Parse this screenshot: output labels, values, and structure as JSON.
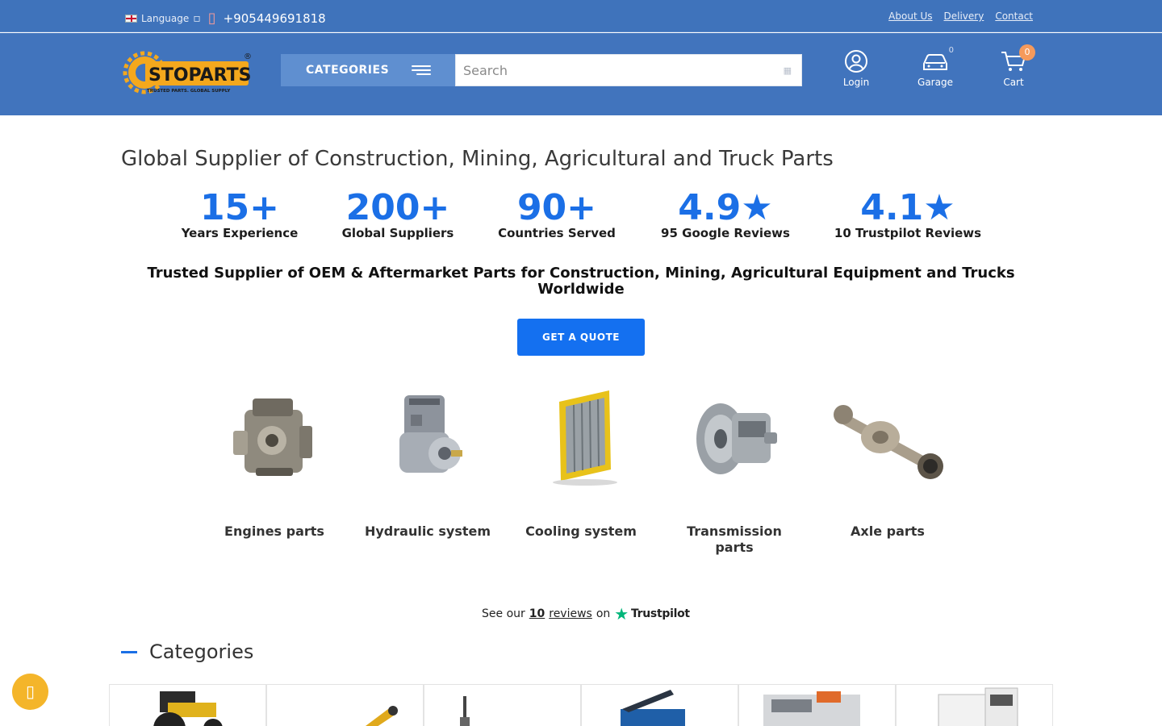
{
  "topbar": {
    "language_label": "Language",
    "phone": "+905449691818",
    "links": [
      "About Us",
      "Delivery",
      "Contact"
    ]
  },
  "header": {
    "logo_text": "STOPARTS",
    "logo_tagline": "TRUSTED PARTS. GLOBAL SUPPLY",
    "categories_label": "CATEGORIES",
    "search_placeholder": "Search",
    "login_label": "Login",
    "garage_label": "Garage",
    "garage_count": "0",
    "cart_label": "Cart",
    "cart_count": "0"
  },
  "main": {
    "headline": "Global Supplier of Construction, Mining, Agricultural and Truck Parts",
    "stats": [
      {
        "num": "15+",
        "label": "Years Experience"
      },
      {
        "num": "200+",
        "label": "Global Suppliers"
      },
      {
        "num": "90+",
        "label": "Countries Served"
      },
      {
        "num": "4.9★",
        "label": "95 Google Reviews"
      },
      {
        "num": "4.1★",
        "label": "10 Trustpilot Reviews"
      }
    ],
    "tagline": "Trusted Supplier of OEM & Aftermarket Parts for Construction, Mining, Agricultural Equipment and Trucks Worldwide",
    "quote_button": "GET A QUOTE",
    "parts": [
      {
        "name": "Engines parts",
        "icon": "engine-image"
      },
      {
        "name": "Hydraulic system",
        "icon": "hydraulic-pump-image"
      },
      {
        "name": "Cooling system",
        "icon": "radiator-image"
      },
      {
        "name": "Transmission parts",
        "icon": "transmission-image"
      },
      {
        "name": "Axle parts",
        "icon": "axle-image"
      }
    ],
    "trust": {
      "prefix": "See our",
      "count": "10",
      "reviews_word": "reviews",
      "on": "on",
      "brand": "Trustpilot"
    },
    "categories_title": "Categories"
  },
  "colors": {
    "header_blue": "#4174bd",
    "accent_blue": "#1b6fe6",
    "chat_yellow": "#f4b52a",
    "cart_badge": "#f59a5c"
  }
}
